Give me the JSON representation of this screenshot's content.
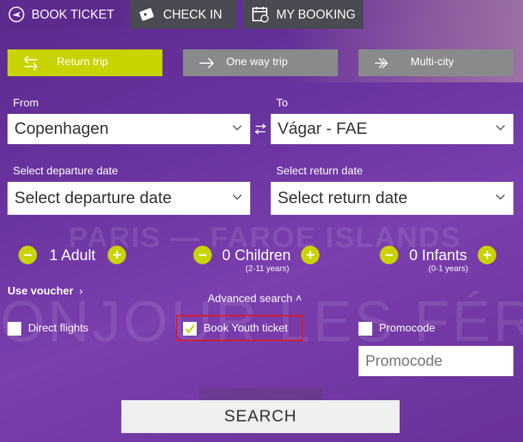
{
  "tabs": {
    "book_ticket": "BOOK TICKET",
    "check_in": "CHECK IN",
    "my_booking": "MY BOOKING"
  },
  "trip_types": {
    "return": "Return trip",
    "one_way": "One way trip",
    "multi_city": "Multi-city"
  },
  "route": {
    "from_label": "From",
    "from_value": "Copenhagen",
    "to_label": "To",
    "to_value": "Vágar - FAE"
  },
  "dates": {
    "departure_label": "Select departure date",
    "departure_value": "Select departure date",
    "return_label": "Select return date",
    "return_value": "Select return date"
  },
  "passengers": {
    "adults": "1 Adult",
    "children": "0 Children",
    "children_sub": "(2-11 years)",
    "infants": "0 Infants",
    "infants_sub": "(0-1 years)"
  },
  "options": {
    "voucher": "Use voucher",
    "advanced_search": "Advanced search",
    "direct_flights": "Direct flights",
    "youth_ticket": "Book Youth ticket",
    "youth_checked": true,
    "promocode": "Promocode",
    "promocode_placeholder": "Promocode"
  },
  "background_text": {
    "line1": "PARIS — FAROE ISLANDS",
    "line2": "ONJOUR LES FÉROÉ"
  },
  "search_button": "SEARCH",
  "colors": {
    "accent": "#c8d400",
    "tab_inactive": "#4a4a52",
    "trip_inactive": "#8a8a8c",
    "highlight": "#e0191e"
  }
}
